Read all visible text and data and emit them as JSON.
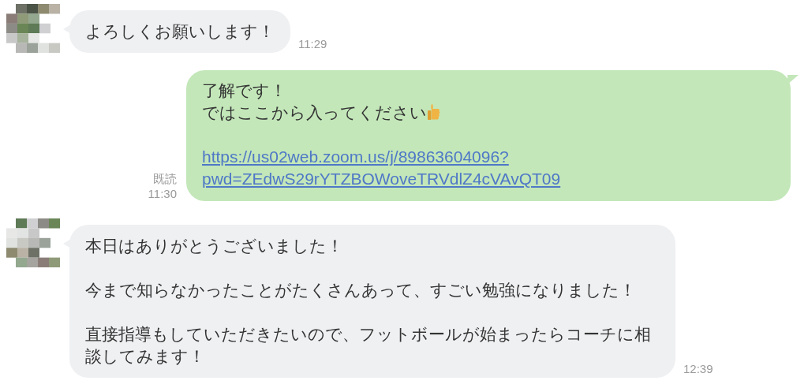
{
  "messages": [
    {
      "kind": "incoming",
      "avatar": {
        "kind": "picture"
      },
      "paragraphs": [
        {
          "kind": "text",
          "lines": [
            {
              "kind": "plain",
              "text": "よろしくお願いします！"
            }
          ]
        }
      ],
      "time": "11:29"
    },
    {
      "kind": "outgoing",
      "read": "既読",
      "paragraphs": [
        {
          "kind": "text",
          "lines": [
            {
              "kind": "plain",
              "text": "了解です！"
            },
            {
              "kind": "thumbs_up",
              "text": "ではここから入ってください"
            }
          ]
        },
        {
          "kind": "link",
          "lines": [
            {
              "kind": "plain",
              "text": "https://us02web.zoom.us/j/89863604096?"
            },
            {
              "kind": "plain",
              "text": "pwd=ZEdwS29rYTZBOWoveTRVdlZ4cVAvQT09"
            }
          ]
        }
      ],
      "time": "11:30"
    },
    {
      "kind": "incoming",
      "avatar": {
        "kind": "picture"
      },
      "paragraphs": [
        {
          "kind": "text",
          "lines": [
            {
              "kind": "plain",
              "text": "本日はありがとうございました！"
            }
          ]
        },
        {
          "kind": "text",
          "lines": [
            {
              "kind": "plain",
              "text": "今まで知らなかったことがたくさんあって、すごい勉強になりました！"
            }
          ]
        },
        {
          "kind": "text",
          "lines": [
            {
              "kind": "plain",
              "text": "直接指導もしていただきたいので、フットボールが始まったらコーチに相談してみます！"
            }
          ]
        }
      ],
      "time": "12:39"
    }
  ]
}
